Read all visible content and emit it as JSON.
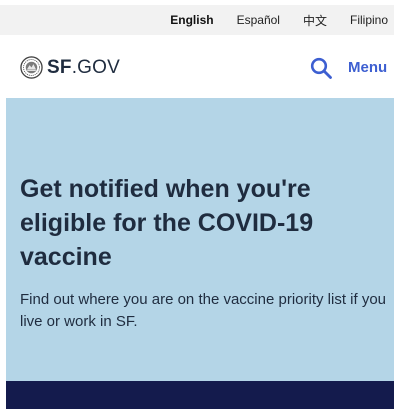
{
  "languages": [
    {
      "label": "English",
      "active": true
    },
    {
      "label": "Español",
      "active": false
    },
    {
      "label": "中文",
      "active": false
    },
    {
      "label": "Filipino",
      "active": false
    }
  ],
  "header": {
    "logo_bold": "SF",
    "logo_rest": ".GOV",
    "menu_label": "Menu",
    "accent_color": "#3d5fd1"
  },
  "hero": {
    "title": "Get notified when you're eligible for the COVID-19 vaccine",
    "subtitle": "Find out where you are on the vaccine priority list if you live or work in SF.",
    "background_color": "#b4d5e7"
  },
  "footer_band_color": "#141b4d",
  "icons": {
    "seal": "city-seal-icon",
    "search": "search-icon"
  }
}
